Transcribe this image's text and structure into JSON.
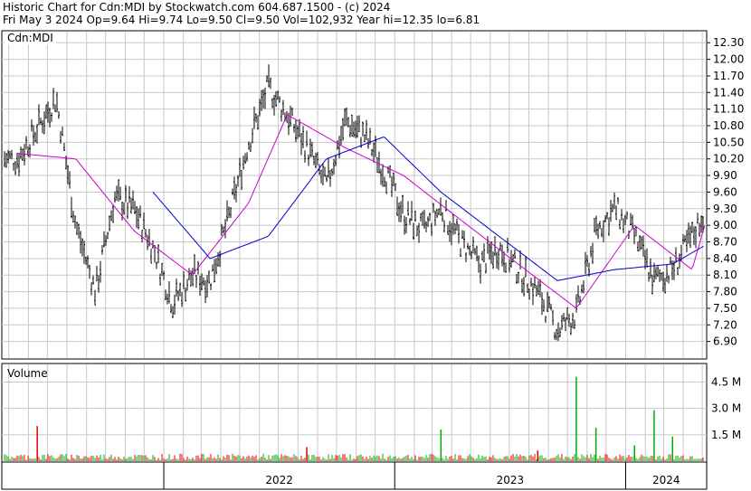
{
  "header": {
    "line1": "Historic Chart for Cdn:MDI by Stockwatch.com 604.687.1500 - (c) 2024",
    "line2": "Fri May  3 2024  Op=9.64  Hi=9.74  Lo=9.50  Cl=9.50  Vol=102,932  Year hi=12.35  lo=6.81"
  },
  "price_panel": {
    "label": "Cdn:MDI"
  },
  "volume_panel": {
    "label": "Volume"
  },
  "colors": {
    "candle": "#000000",
    "ma_short": "#cc00cc",
    "ma_long": "#0000cc",
    "vol_up": "#00aa00",
    "vol_down": "#dd0000",
    "grid": "#c8c8c8"
  },
  "chart_data": [
    {
      "type": "line",
      "title": "Cdn:MDI",
      "y_ticks": [
        "12.30",
        "12.00",
        "11.70",
        "11.40",
        "11.10",
        "10.80",
        "10.50",
        "10.20",
        "9.90",
        "9.60",
        "9.30",
        "9.00",
        "8.70",
        "8.40",
        "8.10",
        "7.80",
        "7.50",
        "7.20",
        "6.90"
      ],
      "ylim": [
        6.6,
        12.5
      ],
      "grid": true,
      "series": [
        {
          "name": "",
          "role": "daily price range",
          "x": [
            "2021-05",
            "2021-07",
            "2021-08",
            "2021-09",
            "2021-10",
            "2021-11",
            "2021-12",
            "2022-01",
            "2022-02",
            "2022-03",
            "2022-04",
            "2022-05",
            "2022-06",
            "2022-07",
            "2022-08",
            "2022-09",
            "2022-10",
            "2022-11",
            "2022-12",
            "2023-01",
            "2023-02",
            "2023-03",
            "2023-04",
            "2023-05",
            "2023-06",
            "2023-07",
            "2023-08",
            "2023-09",
            "2023-10",
            "2023-11",
            "2023-12",
            "2024-01",
            "2024-02",
            "2024-03",
            "2024-04",
            "2024-05"
          ],
          "values": [
            10.2,
            11.3,
            9.0,
            7.8,
            9.5,
            9.3,
            8.6,
            7.6,
            8.1,
            8.0,
            9.2,
            10.5,
            11.5,
            11.0,
            10.4,
            9.7,
            10.9,
            10.6,
            10.0,
            9.2,
            8.9,
            9.3,
            8.7,
            8.3,
            8.6,
            8.2,
            7.8,
            7.1,
            7.4,
            8.9,
            9.3,
            8.8,
            8.0,
            8.2,
            8.8,
            9.5
          ]
        },
        {
          "name": "",
          "role": "short moving average",
          "x": [
            "2021-05",
            "2021-08",
            "2021-11",
            "2022-02",
            "2022-05",
            "2022-07",
            "2022-10",
            "2023-01",
            "2023-04",
            "2023-07",
            "2023-10",
            "2024-01",
            "2024-04",
            "2024-05"
          ],
          "values": [
            10.3,
            10.2,
            8.9,
            8.1,
            9.4,
            11.0,
            10.4,
            9.9,
            9.1,
            8.3,
            7.5,
            9.0,
            8.2,
            9.4
          ]
        },
        {
          "name": "",
          "role": "long moving average",
          "x": [
            "2021-12",
            "2022-03",
            "2022-06",
            "2022-09",
            "2022-12",
            "2023-03",
            "2023-06",
            "2023-09",
            "2023-12",
            "2024-03",
            "2024-05"
          ],
          "values": [
            9.6,
            8.4,
            8.8,
            10.2,
            10.6,
            9.6,
            8.8,
            8.0,
            8.2,
            8.3,
            8.7
          ]
        }
      ]
    },
    {
      "type": "bar",
      "title": "Volume",
      "y_ticks": [
        "4.5 M",
        "3.0 M",
        "1.5 M"
      ],
      "ylim": [
        0,
        5.5
      ],
      "unit": "M",
      "spikes": [
        {
          "x": "2021-06",
          "value": 2.0,
          "color": "down"
        },
        {
          "x": "2022-08",
          "value": 0.8,
          "color": "down"
        },
        {
          "x": "2023-03",
          "value": 1.8,
          "color": "up"
        },
        {
          "x": "2023-08",
          "value": 0.6,
          "color": "down"
        },
        {
          "x": "2023-10",
          "value": 4.8,
          "color": "up"
        },
        {
          "x": "2023-11",
          "value": 1.9,
          "color": "up"
        },
        {
          "x": "2024-01",
          "value": 0.9,
          "color": "up"
        },
        {
          "x": "2024-02",
          "value": 2.9,
          "color": "up"
        },
        {
          "x": "2024-03",
          "value": 1.4,
          "color": "up"
        }
      ],
      "baseline_volume": 0.25
    }
  ],
  "time_axis": {
    "labels": [
      "2022",
      "2023",
      "2024"
    ]
  }
}
